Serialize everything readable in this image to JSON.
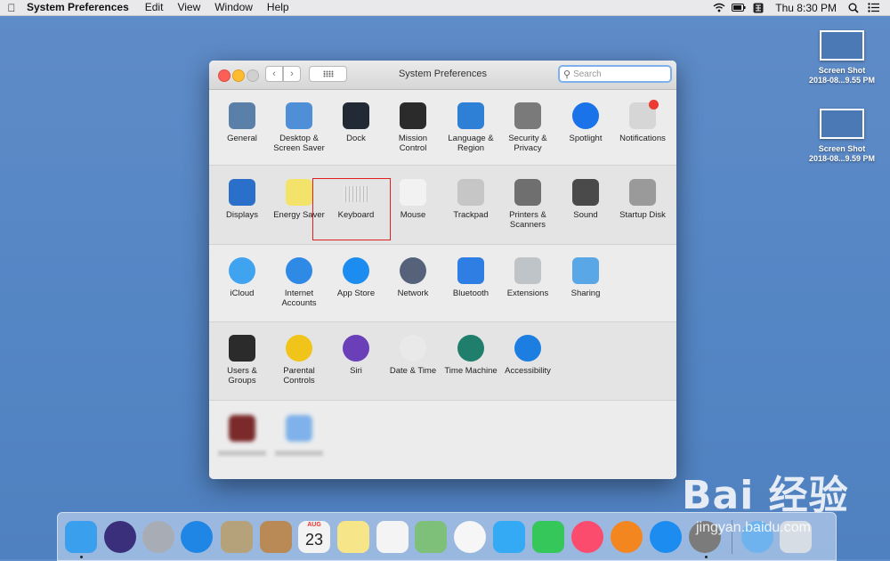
{
  "menubar": {
    "app_name": "System Preferences",
    "items": [
      "Edit",
      "View",
      "Window",
      "Help"
    ],
    "clock": "Thu 8:30 PM"
  },
  "desktop": {
    "files": [
      {
        "name": "Screen Shot",
        "date": "2018-08...9.55 PM"
      },
      {
        "name": "Screen Shot",
        "date": "2018-08...9.59 PM"
      }
    ]
  },
  "window": {
    "title": "System Preferences",
    "search_placeholder": "Search",
    "rows": [
      [
        {
          "label": "General",
          "icon": "general-icon",
          "color": "#5a7fa8"
        },
        {
          "label": "Desktop & Screen Saver",
          "icon": "desktop-screen-saver-icon",
          "color": "#4e8fd8"
        },
        {
          "label": "Dock",
          "icon": "dock-icon",
          "color": "#222a35"
        },
        {
          "label": "Mission Control",
          "icon": "mission-control-icon",
          "color": "#2b2b2b"
        },
        {
          "label": "Language & Region",
          "icon": "language-region-icon",
          "color": "#2e7fd6"
        },
        {
          "label": "Security & Privacy",
          "icon": "security-privacy-icon",
          "color": "#7a7a7a"
        },
        {
          "label": "Spotlight",
          "icon": "spotlight-icon",
          "color": "#1a73e8"
        },
        {
          "label": "Notifications",
          "icon": "notifications-icon",
          "color": "#d6d6d6"
        }
      ],
      [
        {
          "label": "Displays",
          "icon": "displays-icon",
          "color": "#2a6fc9"
        },
        {
          "label": "Energy Saver",
          "icon": "energy-saver-icon",
          "color": "#f3e36a"
        },
        {
          "label": "Keyboard",
          "icon": "keyboard-icon",
          "color": "#cfcfcf"
        },
        {
          "label": "Mouse",
          "icon": "mouse-icon",
          "color": "#f2f2f2"
        },
        {
          "label": "Trackpad",
          "icon": "trackpad-icon",
          "color": "#c6c6c6"
        },
        {
          "label": "Printers & Scanners",
          "icon": "printers-scanners-icon",
          "color": "#6f6f6f"
        },
        {
          "label": "Sound",
          "icon": "sound-icon",
          "color": "#4a4a4a"
        },
        {
          "label": "Startup Disk",
          "icon": "startup-disk-icon",
          "color": "#9a9a9a"
        }
      ],
      [
        {
          "label": "iCloud",
          "icon": "icloud-icon",
          "color": "#3fa3ef"
        },
        {
          "label": "Internet Accounts",
          "icon": "internet-accounts-icon",
          "color": "#2f8ae6"
        },
        {
          "label": "App Store",
          "icon": "app-store-icon",
          "color": "#1c8cf0"
        },
        {
          "label": "Network",
          "icon": "network-icon",
          "color": "#55627a"
        },
        {
          "label": "Bluetooth",
          "icon": "bluetooth-icon",
          "color": "#2f7ee3"
        },
        {
          "label": "Extensions",
          "icon": "extensions-icon",
          "color": "#bfc4c8"
        },
        {
          "label": "Sharing",
          "icon": "sharing-icon",
          "color": "#5aa7e8"
        }
      ],
      [
        {
          "label": "Users & Groups",
          "icon": "users-groups-icon",
          "color": "#2b2b2b"
        },
        {
          "label": "Parental Controls",
          "icon": "parental-controls-icon",
          "color": "#f0c419"
        },
        {
          "label": "Siri",
          "icon": "siri-icon",
          "color": "#6b3fb8"
        },
        {
          "label": "Date & Time",
          "icon": "date-time-icon",
          "color": "#e9e9e9"
        },
        {
          "label": "Time Machine",
          "icon": "time-machine-icon",
          "color": "#1f7f6c"
        },
        {
          "label": "Accessibility",
          "icon": "accessibility-icon",
          "color": "#1b7ee0"
        }
      ]
    ],
    "selected": "Keyboard"
  },
  "dock": {
    "apps": [
      {
        "name": "finder-icon",
        "color": "#3aa0ee"
      },
      {
        "name": "siri-icon",
        "color": "#3a2f7a"
      },
      {
        "name": "launchpad-icon",
        "color": "#a8adb5"
      },
      {
        "name": "safari-icon",
        "color": "#1f86e6"
      },
      {
        "name": "preview-icon",
        "color": "#b6a27a"
      },
      {
        "name": "notebook-icon",
        "color": "#b98a56"
      },
      {
        "name": "calendar-icon",
        "color": "#f3f3f3"
      },
      {
        "name": "notes-icon",
        "color": "#f7e58a"
      },
      {
        "name": "reminders-icon",
        "color": "#f4f4f4"
      },
      {
        "name": "maps-icon",
        "color": "#7ec07a"
      },
      {
        "name": "photos-icon",
        "color": "#f6f6f6"
      },
      {
        "name": "messages-icon",
        "color": "#34aaf4"
      },
      {
        "name": "facetime-icon",
        "color": "#35c759"
      },
      {
        "name": "music-icon",
        "color": "#fb4c6d"
      },
      {
        "name": "books-icon",
        "color": "#f4861f"
      },
      {
        "name": "app-store-icon",
        "color": "#1c8cf0"
      },
      {
        "name": "system-preferences-icon",
        "color": "#7b7b7b"
      },
      {
        "name": "downloads-icon",
        "color": "#6fb3ee"
      },
      {
        "name": "trash-icon",
        "color": "#d7dde4"
      }
    ],
    "calendar_month": "AUG",
    "calendar_day": "23"
  },
  "watermark": {
    "brand": "Bai  经验",
    "url": "jingyan.baidu.com"
  }
}
